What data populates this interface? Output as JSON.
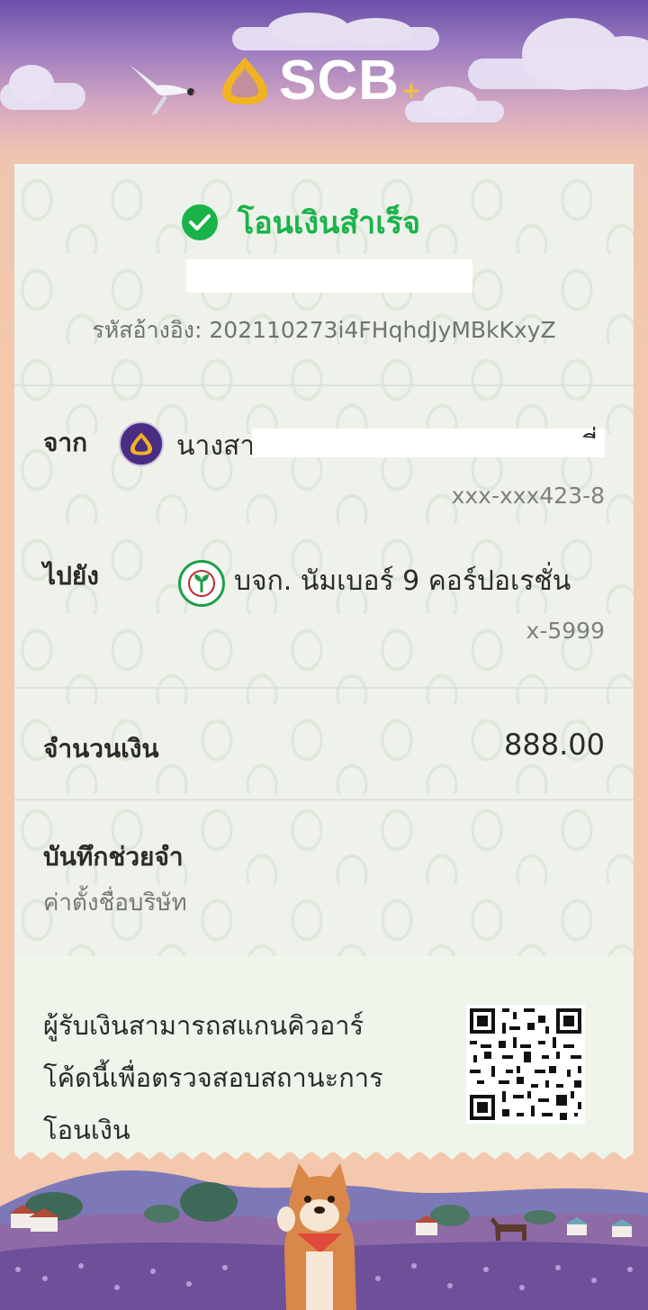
{
  "header": {
    "logo_text": "SCB",
    "logo_plus": "+"
  },
  "status": {
    "title": "โอนเงินสำเร็จ"
  },
  "reference": {
    "label": "รหัสอ้างอิง:",
    "value": "202110273i4FHqhdJyMBkKxyZ"
  },
  "from": {
    "label": "จาก",
    "name_visible": "นางสา",
    "name_tail": "ี่",
    "account": "xxx-xxx423-8"
  },
  "to": {
    "label": "ไปยัง",
    "name": "บจก. นัมเบอร์ 9 คอร์ปอเรชั่น",
    "account": "x-5999"
  },
  "amount": {
    "label": "จำนวนเงิน",
    "value": "888.00"
  },
  "memo": {
    "label": "บันทึกช่วยจำ",
    "value": "ค่าตั้งชื่อบริษัท"
  },
  "qr_info": {
    "line1": "ผู้รับเงินสามารถสแกนคิวอาร์",
    "line2": "โค้ดนี้เพื่อตรวจสอบสถานะการ",
    "line3": "โอนเงิน"
  },
  "colors": {
    "success_green": "#19b34a",
    "scb_purple": "#4a2c82",
    "scb_gold": "#f0b323"
  }
}
